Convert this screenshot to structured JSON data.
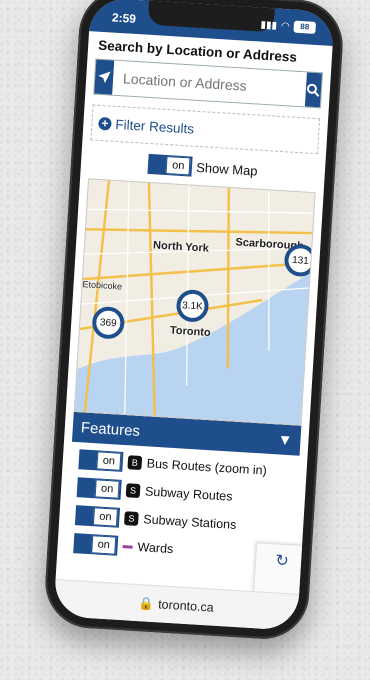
{
  "status_bar": {
    "time": "2:59",
    "battery": "88"
  },
  "search": {
    "heading": "Search by Location or Address",
    "placeholder": "Location or Address"
  },
  "filter": {
    "label": "Filter Results"
  },
  "map_toggle": {
    "state": "on",
    "label": "Show Map"
  },
  "map": {
    "places": [
      "North York",
      "Scarborough",
      "Etobicoke",
      "Toronto"
    ],
    "clusters": [
      "131",
      "3.1K",
      "369"
    ]
  },
  "features": {
    "title": "Features",
    "items": [
      {
        "toggle": "on",
        "label": "Bus Routes (zoom in)",
        "icon": "bus-icon"
      },
      {
        "toggle": "on",
        "label": "Subway Routes",
        "icon": "subway-icon"
      },
      {
        "toggle": "on",
        "label": "Subway Stations",
        "icon": "subway-icon"
      },
      {
        "toggle": "on",
        "label": "Wards",
        "icon": "ward-line-icon"
      }
    ]
  },
  "browser": {
    "url": "toronto.ca"
  },
  "colors": {
    "accent": "#1f4e8c",
    "water": "#b8d4f0",
    "ward": "#9b3fa0"
  }
}
